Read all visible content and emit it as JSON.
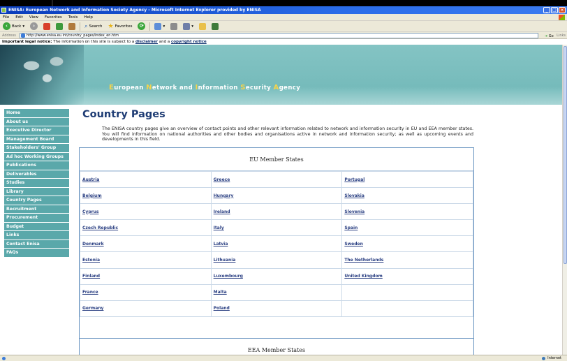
{
  "window": {
    "title": "ENISA: European Network and Information Society Agency - Microsoft Internet Explorer provided by ENISA",
    "buttons": [
      "_",
      "□",
      "×"
    ]
  },
  "menu": [
    "File",
    "Edit",
    "View",
    "Favorites",
    "Tools",
    "Help"
  ],
  "toolbar": {
    "back": "Back",
    "search": "Search",
    "favorites": "Favorites"
  },
  "address": {
    "label": "Address",
    "url": "http://www.enisa.eu.int/country_pages/index_en.htm",
    "go": "Go",
    "links": "Links"
  },
  "notice": {
    "prefix": "Important legal notice:",
    "text": " The information on this site is subject to a ",
    "link1": "disclaimer",
    "mid": " and a ",
    "link2": "copyright notice"
  },
  "banner": {
    "c1": "E",
    "w1": "uropean ",
    "c2": "N",
    "w2": "etwork and ",
    "c3": "I",
    "w3": "nformation ",
    "c4": "S",
    "w4": "ecurity ",
    "c5": "A",
    "w5": "gency"
  },
  "sidebar": {
    "items": [
      {
        "label": "Home"
      },
      {
        "label": "About us"
      },
      {
        "label": "Executive Director"
      },
      {
        "label": "Management Board"
      },
      {
        "label": "Stakeholders' Group"
      },
      {
        "label": "Ad hoc Working Groups"
      },
      {
        "label": "Publications"
      },
      {
        "label": "Deliverables"
      },
      {
        "label": "Studies"
      },
      {
        "label": "Library"
      },
      {
        "label": "Country Pages"
      },
      {
        "label": "Recruitment"
      },
      {
        "label": "Procurement"
      },
      {
        "label": "Budget"
      },
      {
        "label": "Links"
      },
      {
        "label": "Contact Enisa"
      },
      {
        "label": "FAQs"
      }
    ]
  },
  "main": {
    "title": "Country Pages",
    "intro": "The ENISA country pages give an overview of contact points and other relevant information related to network and information security in EU and EEA member states. You will find information on national authorities and other bodies and organisations active in network and information security; as well as upcoming events and developments in this field.",
    "eu_heading": "EU Member States",
    "eu_rows": [
      [
        "Austria",
        "Greece",
        "Portugal"
      ],
      [
        "Belgium",
        "Hungary",
        "Slovakia"
      ],
      [
        "Cyprus",
        "Ireland",
        "Slovenia"
      ],
      [
        "Czech Republic",
        "Italy",
        "Spain"
      ],
      [
        "Denmark",
        "Latvia",
        "Sweden"
      ],
      [
        "Estonia",
        "Lithuania",
        "The Netherlands"
      ],
      [
        "Finland",
        "Luxembourg",
        "United Kingdom"
      ],
      [
        "France",
        "Malta",
        ""
      ],
      [
        "Germany",
        "Poland",
        ""
      ]
    ],
    "eea_heading": "EEA Member States"
  },
  "status": {
    "zone": "Internet"
  }
}
